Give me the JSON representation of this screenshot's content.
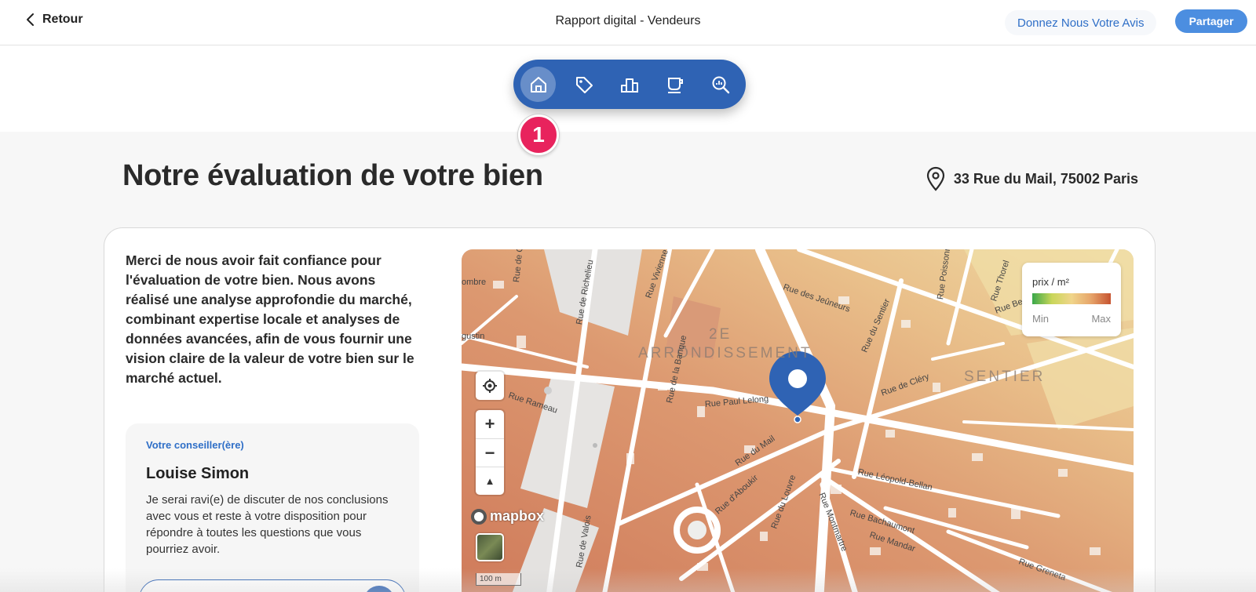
{
  "header": {
    "back_label": "Retour",
    "title": "Rapport digital - Vendeurs",
    "feedback_label": "Donnez Nous Votre Avis",
    "share_label": "Partager"
  },
  "nav": {
    "items": [
      {
        "icon": "home-icon",
        "active": true
      },
      {
        "icon": "tag-icon",
        "active": false
      },
      {
        "icon": "podium-icon",
        "active": false
      },
      {
        "icon": "coffee-cup-icon",
        "active": false
      },
      {
        "icon": "chart-search-icon",
        "active": false
      }
    ],
    "step_number": "1",
    "step_color": "#e8235d",
    "accent_color": "#2f63b4"
  },
  "page": {
    "title": "Notre évaluation de votre bien",
    "address": "33 Rue du Mail, 75002 Paris"
  },
  "intro": {
    "text": "Merci de nous avoir fait confiance pour l'évaluation de votre bien. Nous avons réalisé une analyse approfondie du marché, combinant expertise locale et analyses de données avancées, afin de vous fournir une vision claire de la valeur de votre bien sur le marché actuel."
  },
  "advisor": {
    "role": "Votre conseiller(ère)",
    "name": "Louise Simon",
    "message": "Je serai ravi(e) de discuter de nos conclusions avec vous et reste à votre disposition pour répondre à toutes les questions que vous pourriez avoir."
  },
  "map": {
    "legend_title": "prix / m²",
    "legend_min": "Min",
    "legend_max": "Max",
    "districts": [
      "2E",
      "ARRONDISSEMENT",
      "SENTIER"
    ],
    "streets": [
      "Rue des Jeûneurs",
      "Rue de Gram",
      "Rue de Richelieu",
      "Rue Vivienne",
      "Rue du Sentier",
      "Rue Poissonnière",
      "Rue de Cléry",
      "Rue Paul Lelong",
      "Rue de la Banque",
      "Rue du Mail",
      "Rue d'Aboukir",
      "Rue du Louvre",
      "Rue Montmartre",
      "Rue Léopold-Bellan",
      "Rue Bachaumont",
      "Rue Mandar",
      "Rue Greneta",
      "Rue Rameau",
      "Rue de Valois",
      "Rue Thorel",
      "Rue Be",
      "ombre",
      "gustin"
    ],
    "zoom_in": "+",
    "zoom_out": "−",
    "compass": "▲",
    "attribution": "mapbox",
    "scale_label": "100 m",
    "pin_color": "#2f63b4"
  }
}
